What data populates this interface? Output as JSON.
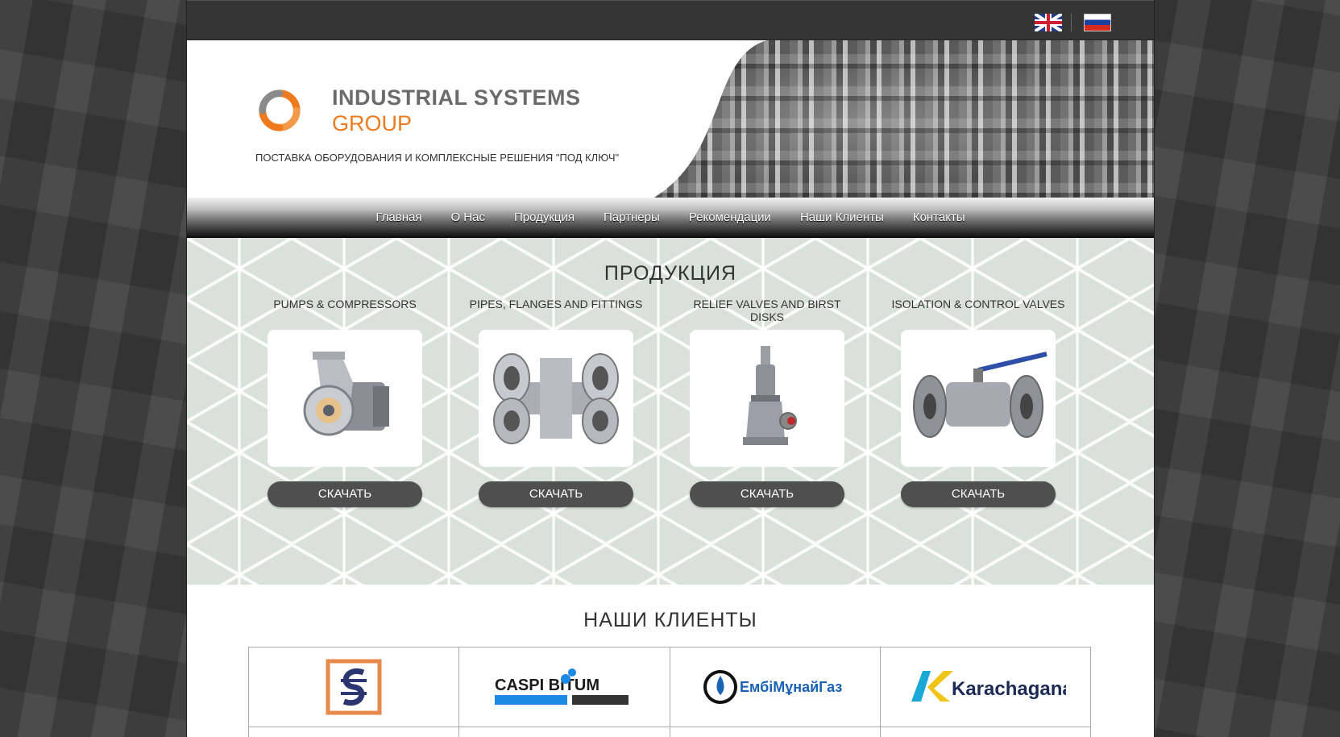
{
  "languages": [
    {
      "code": "en",
      "icon": "uk-flag-icon"
    },
    {
      "code": "ru",
      "icon": "ru-flag-icon"
    }
  ],
  "header": {
    "logo_line1": "INDUSTRIAL SYSTEMS",
    "logo_line2": "GROUP",
    "tagline": "ПОСТАВКА ОБОРУДОВАНИЯ И КОМПЛЕКСНЫЕ РЕШЕНИЯ \"ПОД КЛЮЧ\"",
    "brand_colors": {
      "orange": "#ee7a1d",
      "gray": "#6b6b6b"
    }
  },
  "nav": {
    "items": [
      "Главная",
      "О Нас",
      "Продукция",
      "Партнеры",
      "Рекомендации",
      "Наши Клиенты",
      "Контакты"
    ]
  },
  "products": {
    "heading": "ПРОДУКЦИЯ",
    "download_label": "СКАЧАТЬ",
    "items": [
      {
        "title": "PUMPS & COMPRESSORS",
        "icon": "pump-icon"
      },
      {
        "title": "PIPES, FLANGES AND FITTINGS",
        "icon": "cross-fitting-icon"
      },
      {
        "title": "RELIEF VALVES AND BIRST DISKS",
        "icon": "relief-valve-icon"
      },
      {
        "title": "ISOLATION & CONTROL VALVES",
        "icon": "ball-valve-icon"
      }
    ]
  },
  "clients": {
    "heading": "НАШИ КЛИЕНТЫ",
    "logos": [
      {
        "icon": "s-emblem-logo",
        "text": ""
      },
      {
        "icon": "caspi-bitum-logo",
        "text": "CASPI BITUM"
      },
      {
        "icon": "embimunaigaz-logo",
        "text": "ЕмбiМұнайГаз"
      },
      {
        "icon": "karachaganak-logo",
        "text": "Karachaganak"
      }
    ]
  }
}
